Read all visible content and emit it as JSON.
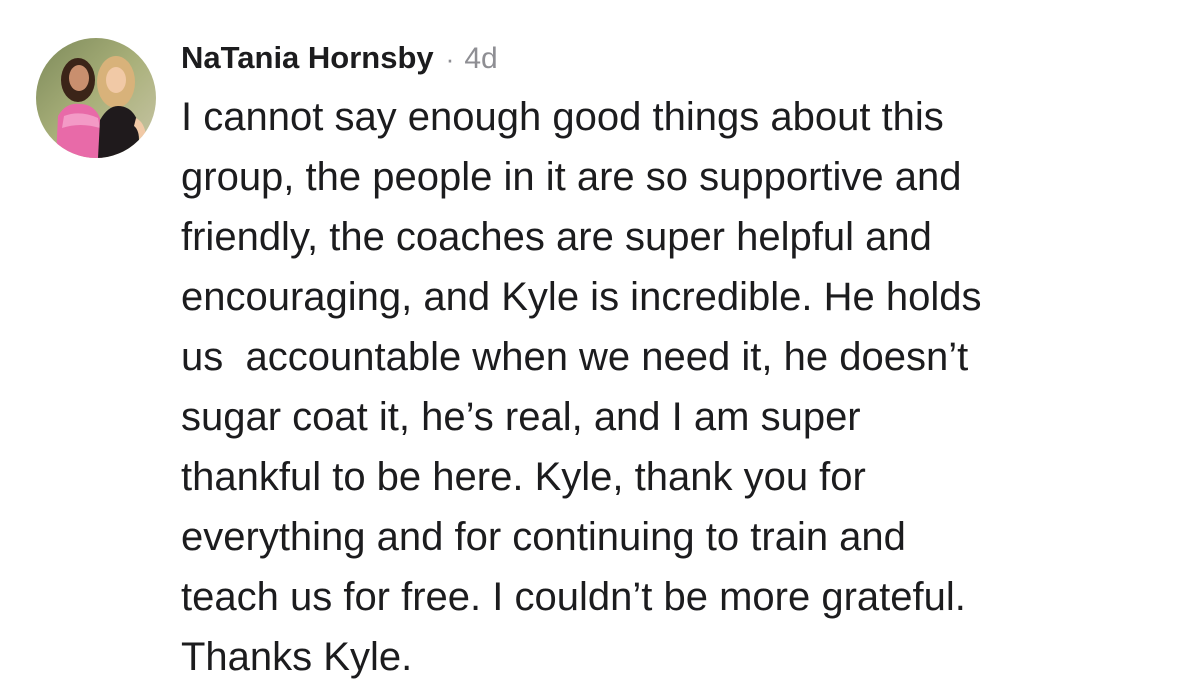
{
  "comment": {
    "author": "NaTania Hornsby",
    "separator": "·",
    "timestamp": "4d",
    "lines": [
      "I cannot say enough good things about this",
      "group, the people in it are so supportive and",
      "friendly, the coaches are super helpful and",
      "encouraging, and Kyle is incredible. He holds",
      "us  accountable when we need it, he doesn’t",
      "sugar coat it, he’s real, and I am super",
      "thankful to be here. Kyle, thank you for",
      "everything and for continuing to train and",
      "teach us for free. I couldn’t be more grateful.",
      "Thanks Kyle."
    ]
  },
  "colors": {
    "text": "#1c1c1e",
    "meta": "#8e8e93",
    "background": "#ffffff"
  },
  "icons": {
    "avatar": "profile-photo"
  }
}
